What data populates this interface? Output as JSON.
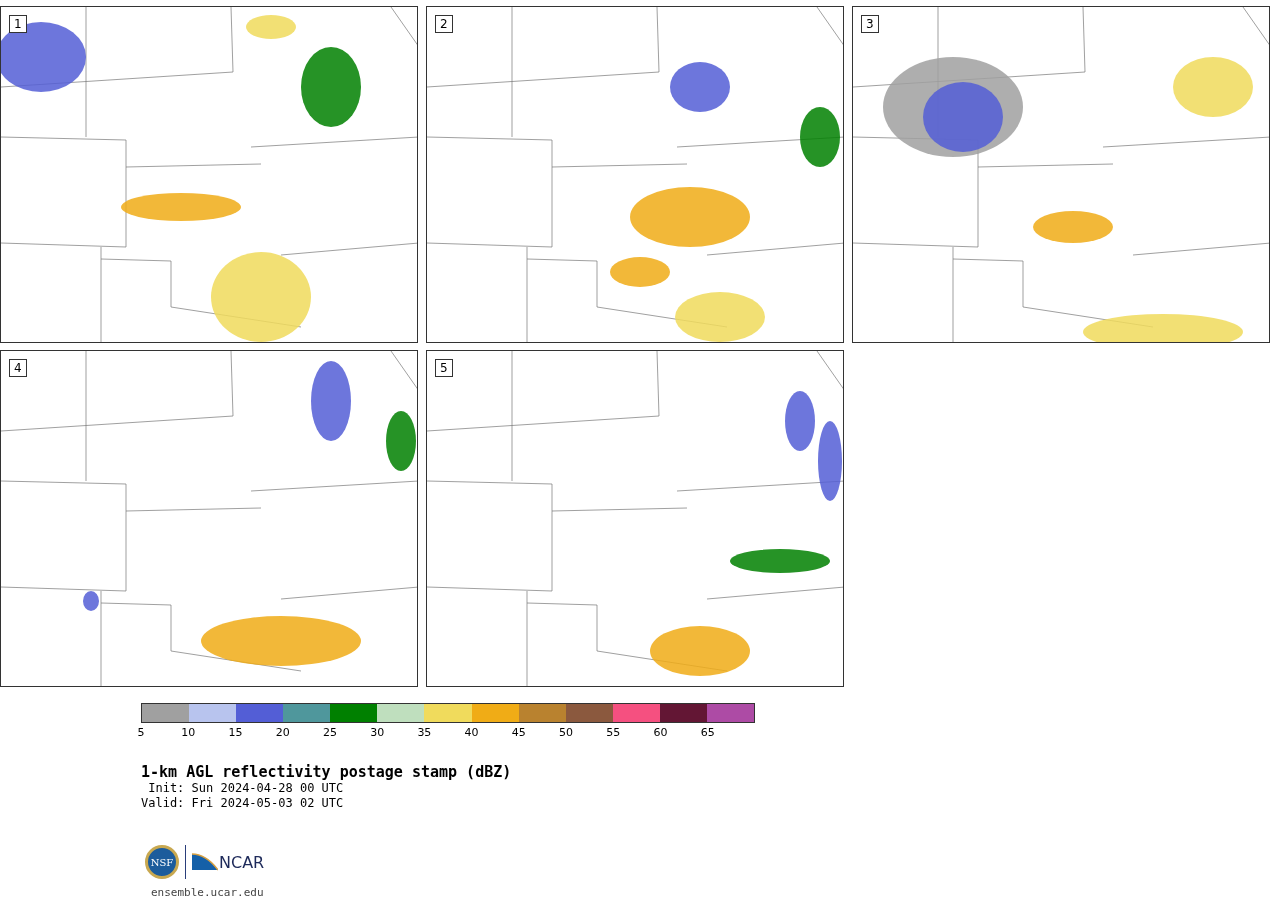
{
  "panels": [
    {
      "number": "1"
    },
    {
      "number": "2"
    },
    {
      "number": "3"
    },
    {
      "number": "4"
    },
    {
      "number": "5"
    }
  ],
  "colorbar": {
    "segments": [
      {
        "color": "#a0a0a0"
      },
      {
        "color": "#b8c4ee"
      },
      {
        "color": "#535ed6"
      },
      {
        "color": "#4f979c"
      },
      {
        "color": "#008000"
      },
      {
        "color": "#bfdfbe"
      },
      {
        "color": "#f0db5c"
      },
      {
        "color": "#f0ac16"
      },
      {
        "color": "#b9822f"
      },
      {
        "color": "#8b593e"
      },
      {
        "color": "#f55080"
      },
      {
        "color": "#631634"
      },
      {
        "color": "#ad4ba5"
      }
    ],
    "ticks": [
      "5",
      "10",
      "15",
      "20",
      "25",
      "30",
      "35",
      "40",
      "45",
      "50",
      "55",
      "60",
      "65"
    ]
  },
  "title": "1-km AGL reflectivity postage stamp (dBZ)",
  "init": " Init: Sun 2024-04-28 00 UTC",
  "valid": "Valid: Fri 2024-05-03 02 UTC",
  "logos": {
    "nsf": "NSF",
    "ncar": "NCAR"
  },
  "footer": "ensemble.ucar.edu"
}
